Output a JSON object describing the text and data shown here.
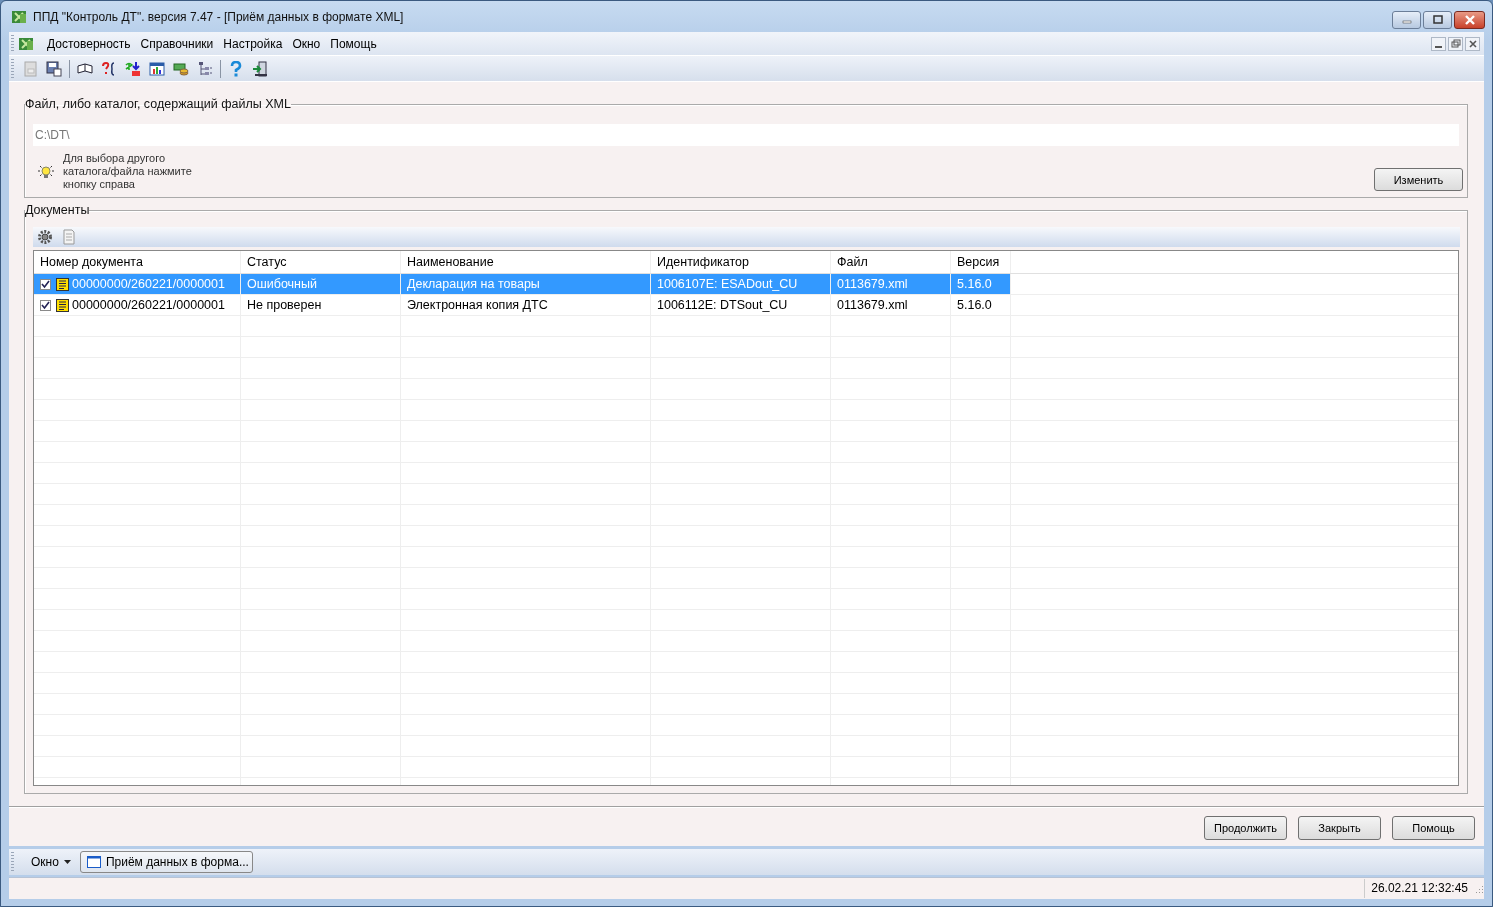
{
  "window": {
    "title": "ППД \"Контроль ДТ\". версия 7.47 - [Приём данных в формате XML]"
  },
  "menu": [
    "Достоверность",
    "Справочники",
    "Настройка",
    "Окно",
    "Помощь"
  ],
  "file_group": {
    "title": "Файл, либо каталог, содержащий файлы XML",
    "path": "C:\\DT\\",
    "hint": "Для выбора другого каталога/файла нажмите кнопку справа",
    "button": "Изменить"
  },
  "documents": {
    "title": "Документы",
    "columns": [
      "Номер документа",
      "Статус",
      "Наименование",
      "Идентификатор",
      "Файл",
      "Версия"
    ],
    "rows": [
      {
        "checked": true,
        "selected": true,
        "cells": [
          "00000000/260221/0000001",
          "Ошибочный",
          "Декларация на товары",
          "1006107E: ESADout_CU",
          "0113679.xml",
          "5.16.0"
        ]
      },
      {
        "checked": true,
        "selected": false,
        "cells": [
          "00000000/260221/0000001",
          "Не проверен",
          "Электронная копия ДТС",
          "1006112E: DTSout_CU",
          "0113679.xml",
          "5.16.0"
        ]
      }
    ]
  },
  "buttons": [
    "Продолжить",
    "Закрыть",
    "Помощь"
  ],
  "taskbar": {
    "window_menu": "Окно",
    "tasks": [
      {
        "label": "Приём данных в форма...",
        "selected": true
      }
    ]
  },
  "status_bar": {
    "datetime": "26.02.21 12:32:45"
  }
}
